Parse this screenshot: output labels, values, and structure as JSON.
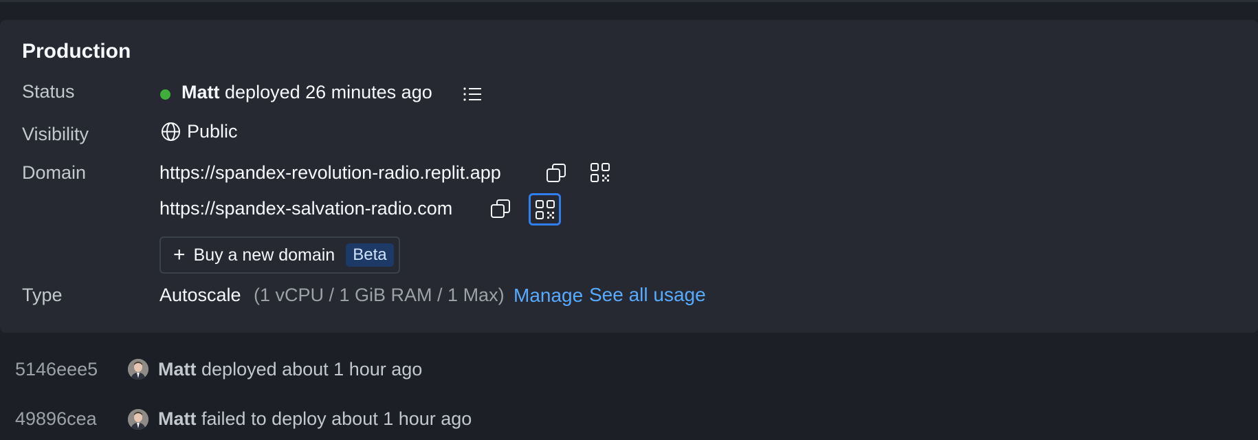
{
  "production": {
    "title": "Production",
    "status": {
      "label": "Status",
      "user": "Matt",
      "text": "deployed 26 minutes ago",
      "dot_color": "#3fae3a",
      "logs_icon": "list-icon"
    },
    "visibility": {
      "label": "Visibility",
      "value": "Public",
      "icon": "globe-icon"
    },
    "domain": {
      "label": "Domain",
      "urls": [
        "https://spandex-revolution-radio.replit.app",
        "https://spandex-salvation-radio.com"
      ],
      "copy_icon": "copy-icon",
      "qr_icon": "qr-code-icon",
      "buy_label": "Buy a new domain",
      "buy_badge": "Beta"
    },
    "type": {
      "label": "Type",
      "value": "Autoscale",
      "detail": "(1 vCPU / 1 GiB RAM / 1 Max)",
      "manage_link": "Manage",
      "usage_link": "See all usage"
    }
  },
  "history": [
    {
      "hash": "5146eee5",
      "user": "Matt",
      "text": "deployed about 1 hour ago"
    },
    {
      "hash": "49896cea",
      "user": "Matt",
      "text": "failed to deploy about 1 hour ago"
    }
  ],
  "colors": {
    "background": "#1c1f26",
    "card": "#262932",
    "link": "#57abff",
    "focus_ring": "#2f7ff0",
    "badge_bg": "#1d3a66"
  }
}
